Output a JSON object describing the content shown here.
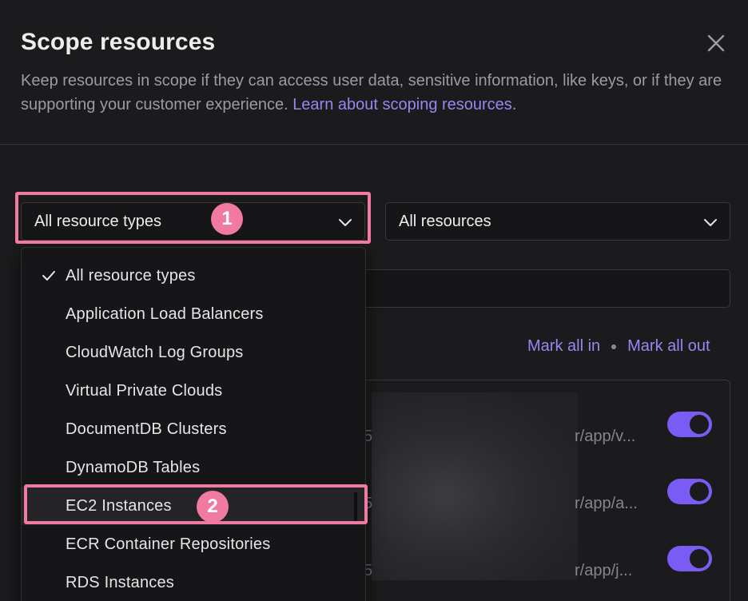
{
  "modal": {
    "title": "Scope resources",
    "description": "Keep resources in scope if they can access user data, sensitive information, like keys, or if they are supporting your customer experience.",
    "link_text": "Learn about scoping resources",
    "link_suffix": "."
  },
  "filters": {
    "type_select": "All resource types",
    "resource_select": "All resources"
  },
  "actions": {
    "mark_all_in": "Mark all in",
    "mark_all_out": "Mark all out"
  },
  "dropdown": {
    "selected": "All resource types",
    "options": [
      "All resource types",
      "Application Load Balancers",
      "CloudWatch Log Groups",
      "Virtual Private Clouds",
      "DocumentDB Clusters",
      "DynamoDB Tables",
      "EC2 Instances",
      "ECR Container Repositories",
      "RDS Instances"
    ]
  },
  "rows": [
    {
      "fragment": "5",
      "path": "r/app/v...",
      "in_scope": true
    },
    {
      "fragment": "5",
      "path": "r/app/a...",
      "in_scope": true
    },
    {
      "fragment": "5",
      "path": "r/app/j...",
      "in_scope": true
    }
  ],
  "annotations": {
    "step1": "1",
    "step2": "2"
  },
  "colors": {
    "accent": "#7a5cf4",
    "link": "#9a86f0",
    "highlight": "#f07aa0",
    "background": "#1b1b1d"
  }
}
